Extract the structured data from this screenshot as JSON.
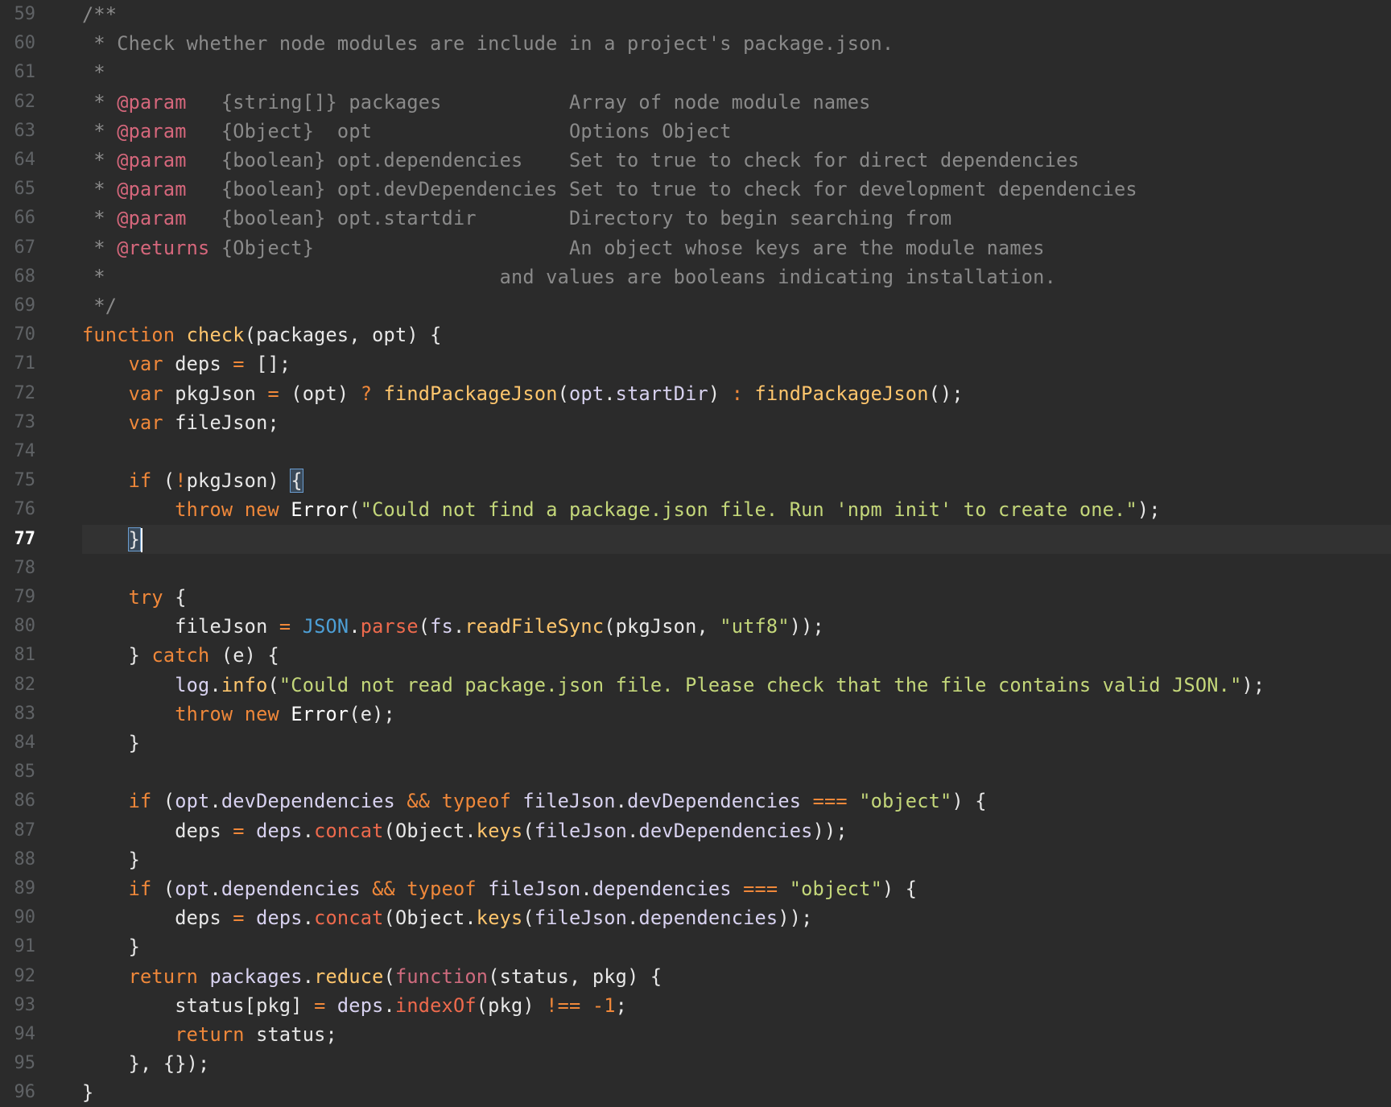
{
  "editor": {
    "current_line": 77,
    "lines": [
      {
        "n": "59",
        "tokens": [
          [
            "c",
            "/**"
          ]
        ]
      },
      {
        "n": "60",
        "tokens": [
          [
            "c",
            " * Check whether node modules are include in a project's package.json."
          ]
        ]
      },
      {
        "n": "61",
        "tokens": [
          [
            "c",
            " *"
          ]
        ]
      },
      {
        "n": "62",
        "tokens": [
          [
            "c",
            " * "
          ],
          [
            "tag",
            "@param"
          ],
          [
            "c",
            "   {string[]} packages           Array of node module names"
          ]
        ]
      },
      {
        "n": "63",
        "tokens": [
          [
            "c",
            " * "
          ],
          [
            "tag",
            "@param"
          ],
          [
            "c",
            "   {Object}  opt                 Options Object"
          ]
        ]
      },
      {
        "n": "64",
        "tokens": [
          [
            "c",
            " * "
          ],
          [
            "tag",
            "@param"
          ],
          [
            "c",
            "   {boolean} opt.dependencies    Set to true to check for direct dependencies"
          ]
        ]
      },
      {
        "n": "65",
        "tokens": [
          [
            "c",
            " * "
          ],
          [
            "tag",
            "@param"
          ],
          [
            "c",
            "   {boolean} opt.devDependencies Set to true to check for development dependencies"
          ]
        ]
      },
      {
        "n": "66",
        "tokens": [
          [
            "c",
            " * "
          ],
          [
            "tag",
            "@param"
          ],
          [
            "c",
            "   {boolean} opt.startdir        Directory to begin searching from"
          ]
        ]
      },
      {
        "n": "67",
        "tokens": [
          [
            "c",
            " * "
          ],
          [
            "tag",
            "@returns"
          ],
          [
            "c",
            " {Object}                      An object whose keys are the module names"
          ]
        ]
      },
      {
        "n": "68",
        "tokens": [
          [
            "c",
            " *                                  and values are booleans indicating installation."
          ]
        ]
      },
      {
        "n": "69",
        "tokens": [
          [
            "c",
            " */"
          ]
        ]
      },
      {
        "n": "70",
        "tokens": [
          [
            "kw",
            "function"
          ],
          [
            "p",
            " "
          ],
          [
            "fname",
            "check"
          ],
          [
            "p",
            "(packages, opt) {"
          ]
        ]
      },
      {
        "n": "71",
        "tokens": [
          [
            "p",
            "    "
          ],
          [
            "kw",
            "var"
          ],
          [
            "p",
            " deps "
          ],
          [
            "op",
            "="
          ],
          [
            "p",
            " [];"
          ]
        ]
      },
      {
        "n": "72",
        "tokens": [
          [
            "p",
            "    "
          ],
          [
            "kw",
            "var"
          ],
          [
            "p",
            " pkgJson "
          ],
          [
            "op",
            "="
          ],
          [
            "p",
            " (opt) "
          ],
          [
            "op",
            "?"
          ],
          [
            "p",
            " "
          ],
          [
            "fname",
            "findPackageJson"
          ],
          [
            "p",
            "("
          ],
          [
            "var",
            "opt"
          ],
          [
            "p",
            "."
          ],
          [
            "var",
            "startDir"
          ],
          [
            "p",
            ") "
          ],
          [
            "op",
            ":"
          ],
          [
            "p",
            " "
          ],
          [
            "fname",
            "findPackageJson"
          ],
          [
            "p",
            "();"
          ]
        ]
      },
      {
        "n": "73",
        "tokens": [
          [
            "p",
            "    "
          ],
          [
            "kw",
            "var"
          ],
          [
            "p",
            " fileJson;"
          ]
        ]
      },
      {
        "n": "74",
        "tokens": []
      },
      {
        "n": "75",
        "tokens": [
          [
            "p",
            "    "
          ],
          [
            "kw",
            "if"
          ],
          [
            "p",
            " ("
          ],
          [
            "op",
            "!"
          ],
          [
            "p",
            "pkgJson) "
          ],
          [
            "brace",
            "{"
          ]
        ]
      },
      {
        "n": "76",
        "tokens": [
          [
            "p",
            "        "
          ],
          [
            "kw",
            "throw"
          ],
          [
            "p",
            " "
          ],
          [
            "kw",
            "new"
          ],
          [
            "p",
            " "
          ],
          [
            "cls",
            "Error"
          ],
          [
            "p",
            "("
          ],
          [
            "str",
            "\"Could not find a package.json file. Run 'npm init' to create one.\""
          ],
          [
            "p",
            ");"
          ]
        ]
      },
      {
        "n": "77",
        "tokens": [
          [
            "p",
            "    "
          ],
          [
            "brace",
            "}"
          ],
          [
            "caret",
            ""
          ]
        ]
      },
      {
        "n": "78",
        "tokens": []
      },
      {
        "n": "79",
        "tokens": [
          [
            "p",
            "    "
          ],
          [
            "kw",
            "try"
          ],
          [
            "p",
            " {"
          ]
        ]
      },
      {
        "n": "80",
        "tokens": [
          [
            "p",
            "        fileJson "
          ],
          [
            "op",
            "="
          ],
          [
            "p",
            " "
          ],
          [
            "json",
            "JSON"
          ],
          [
            "p",
            "."
          ],
          [
            "method",
            "parse"
          ],
          [
            "p",
            "("
          ],
          [
            "var",
            "fs"
          ],
          [
            "p",
            "."
          ],
          [
            "fname",
            "readFileSync"
          ],
          [
            "p",
            "(pkgJson, "
          ],
          [
            "str",
            "\"utf8\""
          ],
          [
            "p",
            "));"
          ]
        ]
      },
      {
        "n": "81",
        "tokens": [
          [
            "p",
            "    } "
          ],
          [
            "kw",
            "catch"
          ],
          [
            "p",
            " (e) {"
          ]
        ]
      },
      {
        "n": "82",
        "tokens": [
          [
            "p",
            "        "
          ],
          [
            "var",
            "log"
          ],
          [
            "p",
            "."
          ],
          [
            "fname",
            "info"
          ],
          [
            "p",
            "("
          ],
          [
            "str",
            "\"Could not read package.json file. Please check that the file contains valid JSON.\""
          ],
          [
            "p",
            ");"
          ]
        ]
      },
      {
        "n": "83",
        "tokens": [
          [
            "p",
            "        "
          ],
          [
            "kw",
            "throw"
          ],
          [
            "p",
            " "
          ],
          [
            "kw",
            "new"
          ],
          [
            "p",
            " "
          ],
          [
            "cls",
            "Error"
          ],
          [
            "p",
            "(e);"
          ]
        ]
      },
      {
        "n": "84",
        "tokens": [
          [
            "p",
            "    }"
          ]
        ]
      },
      {
        "n": "85",
        "tokens": []
      },
      {
        "n": "86",
        "tokens": [
          [
            "p",
            "    "
          ],
          [
            "kw",
            "if"
          ],
          [
            "p",
            " ("
          ],
          [
            "var",
            "opt"
          ],
          [
            "p",
            "."
          ],
          [
            "var",
            "devDependencies"
          ],
          [
            "p",
            " "
          ],
          [
            "op",
            "&&"
          ],
          [
            "p",
            " "
          ],
          [
            "kw",
            "typeof"
          ],
          [
            "p",
            " "
          ],
          [
            "var",
            "fileJson"
          ],
          [
            "p",
            "."
          ],
          [
            "var",
            "devDependencies"
          ],
          [
            "p",
            " "
          ],
          [
            "op",
            "==="
          ],
          [
            "p",
            " "
          ],
          [
            "str",
            "\"object\""
          ],
          [
            "p",
            ") {"
          ]
        ]
      },
      {
        "n": "87",
        "tokens": [
          [
            "p",
            "        deps "
          ],
          [
            "op",
            "="
          ],
          [
            "p",
            " "
          ],
          [
            "var",
            "deps"
          ],
          [
            "p",
            "."
          ],
          [
            "method",
            "concat"
          ],
          [
            "p",
            "(Object."
          ],
          [
            "fname",
            "keys"
          ],
          [
            "p",
            "("
          ],
          [
            "var",
            "fileJson"
          ],
          [
            "p",
            "."
          ],
          [
            "var",
            "devDependencies"
          ],
          [
            "p",
            "));"
          ]
        ]
      },
      {
        "n": "88",
        "tokens": [
          [
            "p",
            "    }"
          ]
        ]
      },
      {
        "n": "89",
        "tokens": [
          [
            "p",
            "    "
          ],
          [
            "kw",
            "if"
          ],
          [
            "p",
            " ("
          ],
          [
            "var",
            "opt"
          ],
          [
            "p",
            "."
          ],
          [
            "var",
            "dependencies"
          ],
          [
            "p",
            " "
          ],
          [
            "op",
            "&&"
          ],
          [
            "p",
            " "
          ],
          [
            "kw",
            "typeof"
          ],
          [
            "p",
            " "
          ],
          [
            "var",
            "fileJson"
          ],
          [
            "p",
            "."
          ],
          [
            "var",
            "dependencies"
          ],
          [
            "p",
            " "
          ],
          [
            "op",
            "==="
          ],
          [
            "p",
            " "
          ],
          [
            "str",
            "\"object\""
          ],
          [
            "p",
            ") {"
          ]
        ]
      },
      {
        "n": "90",
        "tokens": [
          [
            "p",
            "        deps "
          ],
          [
            "op",
            "="
          ],
          [
            "p",
            " "
          ],
          [
            "var",
            "deps"
          ],
          [
            "p",
            "."
          ],
          [
            "method",
            "concat"
          ],
          [
            "p",
            "(Object."
          ],
          [
            "fname",
            "keys"
          ],
          [
            "p",
            "("
          ],
          [
            "var",
            "fileJson"
          ],
          [
            "p",
            "."
          ],
          [
            "var",
            "dependencies"
          ],
          [
            "p",
            "));"
          ]
        ]
      },
      {
        "n": "91",
        "tokens": [
          [
            "p",
            "    }"
          ]
        ]
      },
      {
        "n": "92",
        "tokens": [
          [
            "p",
            "    "
          ],
          [
            "kw",
            "return"
          ],
          [
            "p",
            " "
          ],
          [
            "var",
            "packages"
          ],
          [
            "p",
            "."
          ],
          [
            "fname",
            "reduce"
          ],
          [
            "p",
            "("
          ],
          [
            "func",
            "function"
          ],
          [
            "p",
            "(status, pkg) {"
          ]
        ]
      },
      {
        "n": "93",
        "tokens": [
          [
            "p",
            "        status[pkg] "
          ],
          [
            "op",
            "="
          ],
          [
            "p",
            " "
          ],
          [
            "var",
            "deps"
          ],
          [
            "p",
            "."
          ],
          [
            "method",
            "indexOf"
          ],
          [
            "p",
            "(pkg) "
          ],
          [
            "op",
            "!=="
          ],
          [
            "p",
            " "
          ],
          [
            "num",
            "-1"
          ],
          [
            "p",
            ";"
          ]
        ]
      },
      {
        "n": "94",
        "tokens": [
          [
            "p",
            "        "
          ],
          [
            "kw",
            "return"
          ],
          [
            "p",
            " status;"
          ]
        ]
      },
      {
        "n": "95",
        "tokens": [
          [
            "p",
            "    }, {});"
          ]
        ]
      },
      {
        "n": "96",
        "tokens": [
          [
            "p",
            "}"
          ]
        ]
      }
    ]
  }
}
